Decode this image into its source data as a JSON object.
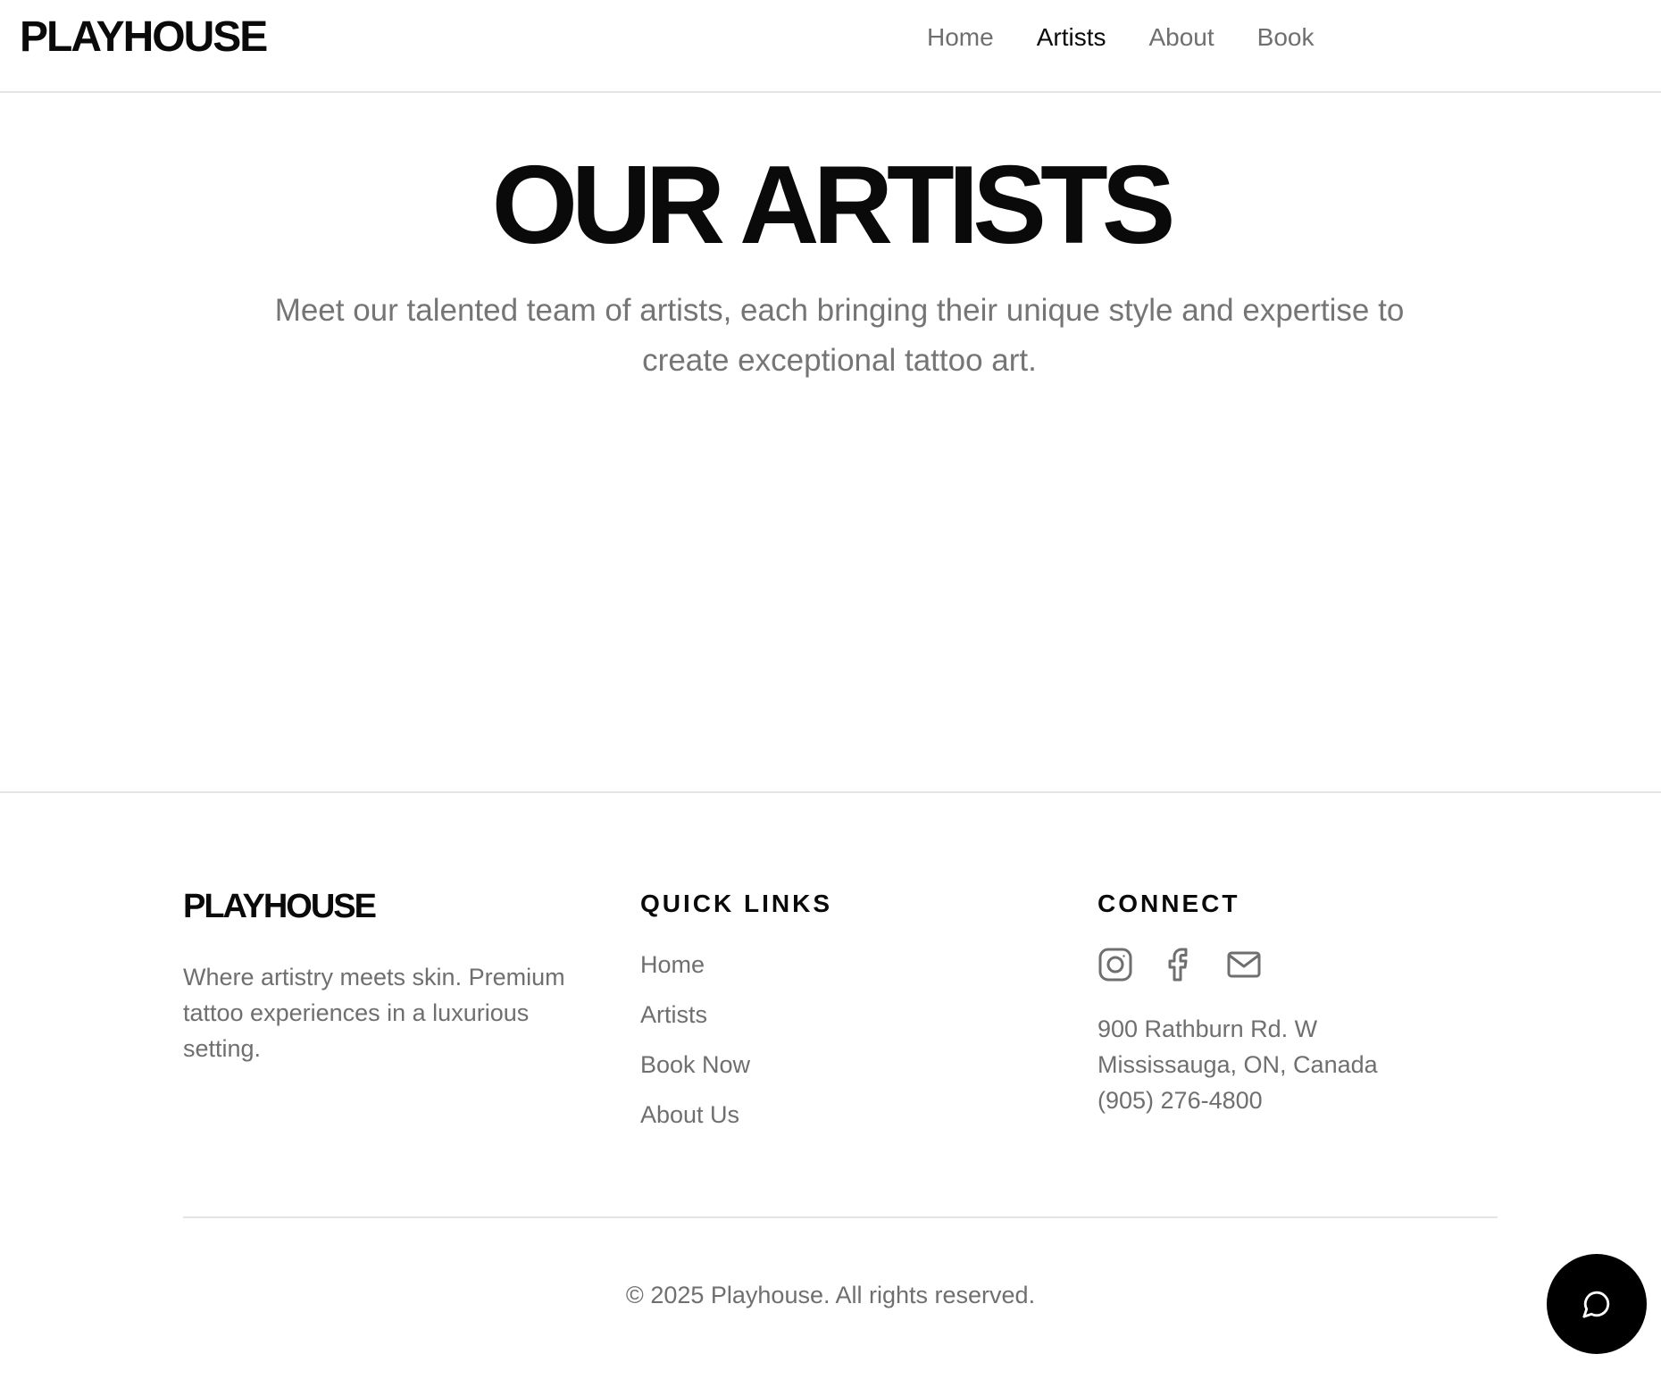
{
  "header": {
    "logo": "PLAYHOUSE",
    "nav": [
      {
        "label": "Home",
        "active": false
      },
      {
        "label": "Artists",
        "active": true
      },
      {
        "label": "About",
        "active": false
      },
      {
        "label": "Book",
        "active": false
      }
    ]
  },
  "hero": {
    "title": "OUR ARTISTS",
    "subtitle": "Meet our talented team of artists, each bringing their unique style and expertise to create exceptional tattoo art."
  },
  "footer": {
    "logo": "PLAYHOUSE",
    "tagline": "Where artistry meets skin. Premium tattoo experiences in a luxurious setting.",
    "quick_links": {
      "heading": "QUICK LINKS",
      "items": [
        "Home",
        "Artists",
        "Book Now",
        "About Us"
      ]
    },
    "connect": {
      "heading": "CONNECT",
      "icons": [
        "instagram-icon",
        "facebook-icon",
        "mail-icon"
      ],
      "address_lines": [
        "900 Rathburn Rd. W",
        "Mississauga, ON, Canada",
        "(905) 276-4800"
      ]
    },
    "copyright": "© 2025 Playhouse. All rights reserved."
  },
  "chat": {
    "icon": "chat-bubble-icon"
  },
  "colors": {
    "text_primary": "#0a0a0a",
    "text_muted": "#6f6f6f",
    "border": "#e4e4e4",
    "chat_button": "#000000"
  }
}
